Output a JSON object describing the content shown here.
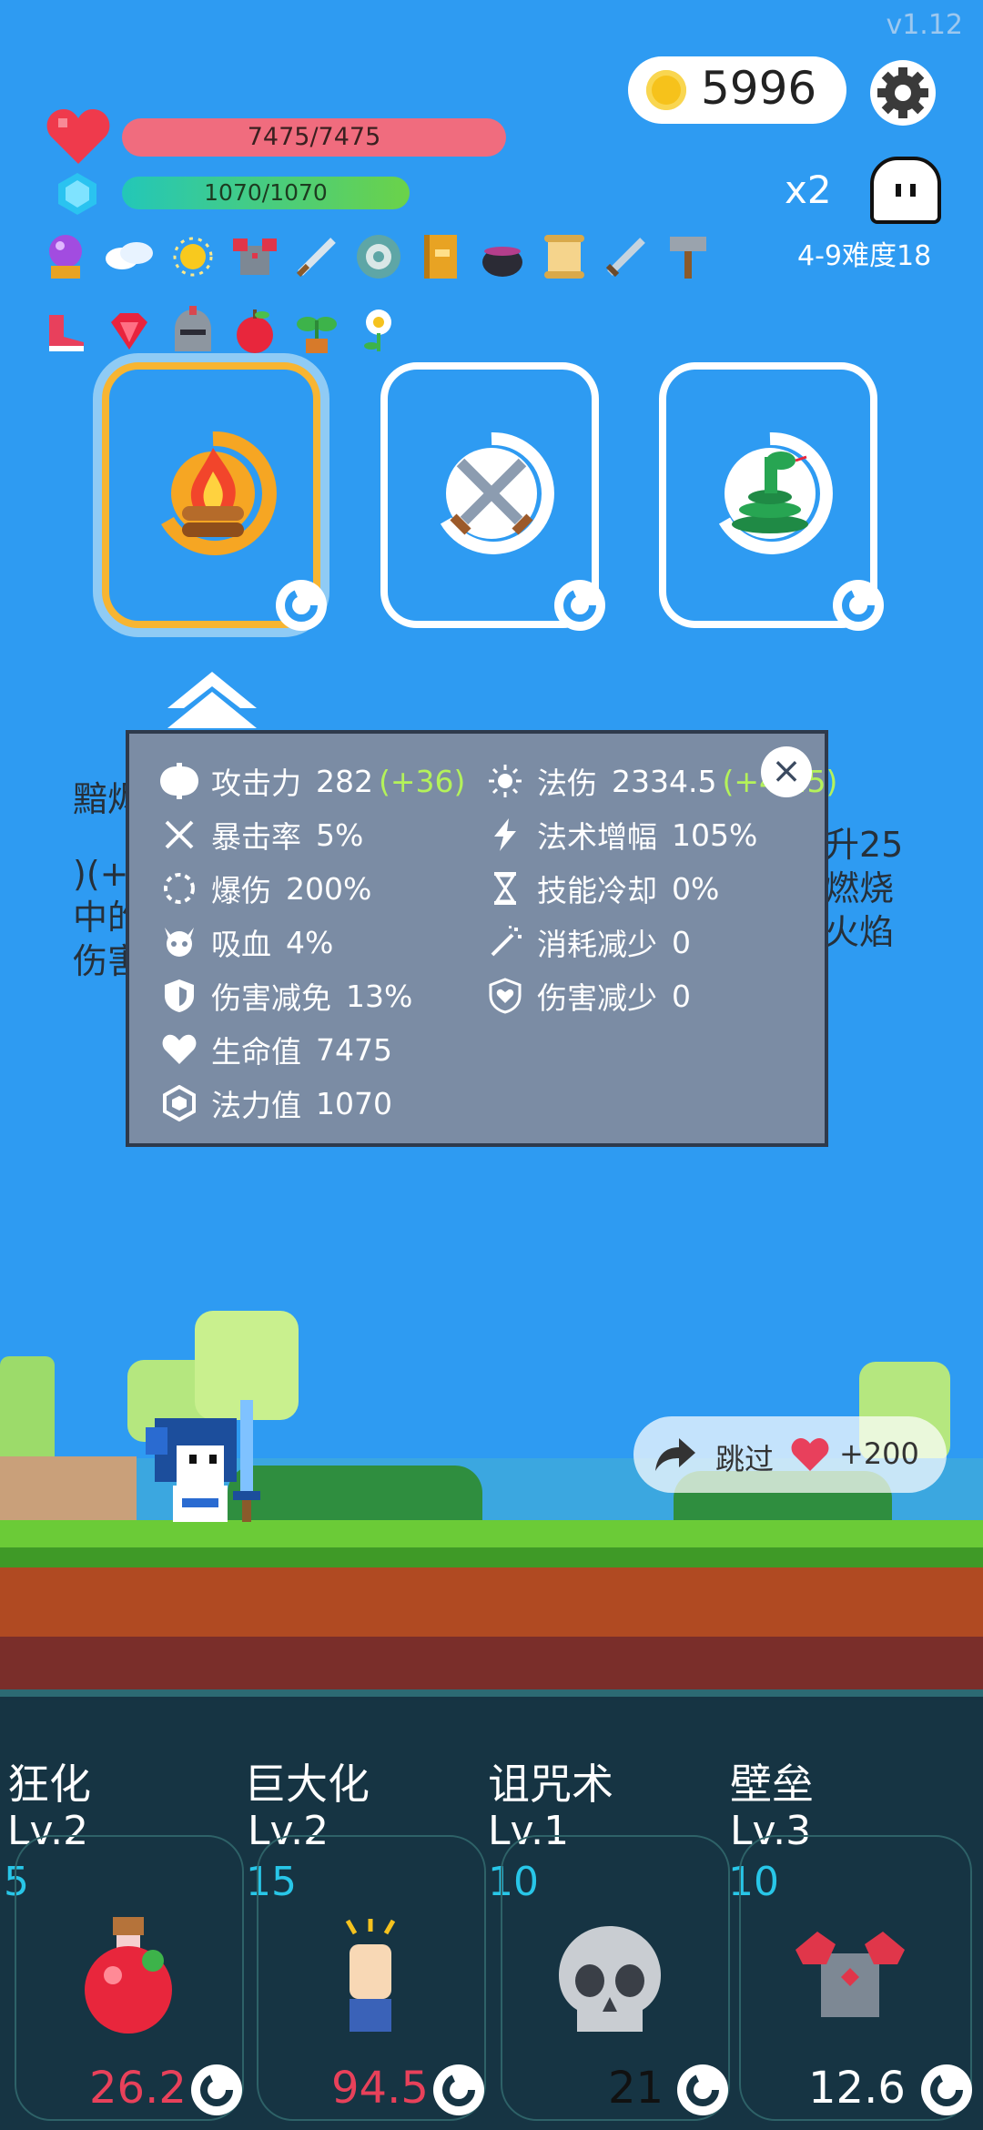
{
  "version": "v1.12",
  "currency": {
    "coins": "5996"
  },
  "player": {
    "hp_text": "7475/7475",
    "hp_fraction": 1.0,
    "mp_text": "1070/1070",
    "mp_fraction": 1.0
  },
  "top_right": {
    "multiplier": "x2",
    "stage": "4-9难度18"
  },
  "relics": [
    "crystal-ball-icon",
    "wings-icon",
    "sun-orb-icon",
    "armor-icon",
    "sword-icon",
    "shield-icon",
    "book-icon",
    "cauldron-icon",
    "scroll-icon",
    "sword2-icon",
    "hammer-icon",
    "boots-icon",
    "ruby-icon",
    "helmet-icon",
    "apple-icon",
    "plant-icon",
    "flower-icon"
  ],
  "choices": [
    {
      "icon": "campfire-icon",
      "selected": true
    },
    {
      "icon": "crossed-swords-icon",
      "selected": false
    },
    {
      "icon": "snake-icon",
      "selected": false
    }
  ],
  "stats_panel": {
    "left": [
      {
        "icon": "axe-icon",
        "name": "攻击力",
        "value": "282",
        "bonus": "(+36)"
      },
      {
        "icon": "crit-icon",
        "name": "暴击率",
        "value": "5%"
      },
      {
        "icon": "burst-icon",
        "name": "爆伤",
        "value": "200%"
      },
      {
        "icon": "skull-horn-icon",
        "name": "吸血",
        "value": "4%"
      },
      {
        "icon": "shield-icon",
        "name": "伤害减免",
        "value": "13%"
      },
      {
        "icon": "heart-icon",
        "name": "生命值",
        "value": "7475"
      },
      {
        "icon": "crystal-icon",
        "name": "法力值",
        "value": "1070"
      }
    ],
    "right": [
      {
        "icon": "sun-icon",
        "name": "法伤",
        "value": "2334.5",
        "bonus": "(+47.5)"
      },
      {
        "icon": "lightning-icon",
        "name": "法术增幅",
        "value": "105%"
      },
      {
        "icon": "hourglass-icon",
        "name": "技能冷却",
        "value": "0%"
      },
      {
        "icon": "wand-icon",
        "name": "消耗减少",
        "value": "0"
      },
      {
        "icon": "heart-shield-icon",
        "name": "伤害减少",
        "value": "0"
      }
    ]
  },
  "background_text": {
    "left_lines": [
      "黯烬",
      ")(+",
      "中的",
      "伤害"
    ],
    "right_lines": [
      "升25",
      "燃烧",
      "火焰"
    ]
  },
  "skip_button": {
    "label": "跳过",
    "reward": "+200"
  },
  "skills": [
    {
      "name": "狂化",
      "level": "Lv.2",
      "cost": "5",
      "value": "26.2",
      "value_color": "#E8415A",
      "icon": "red-potion-icon"
    },
    {
      "name": "巨大化",
      "level": "Lv.2",
      "cost": "15",
      "value": "94.5",
      "value_color": "#E8415A",
      "icon": "hand-icon"
    },
    {
      "name": "诅咒术",
      "level": "Lv.1",
      "cost": "10",
      "value": "21",
      "value_color": "#111111",
      "icon": "skull-icon"
    },
    {
      "name": "壁垒",
      "level": "Lv.3",
      "cost": "10",
      "value": "12.6",
      "value_color": "#FFFFFF",
      "icon": "armor-icon"
    }
  ]
}
